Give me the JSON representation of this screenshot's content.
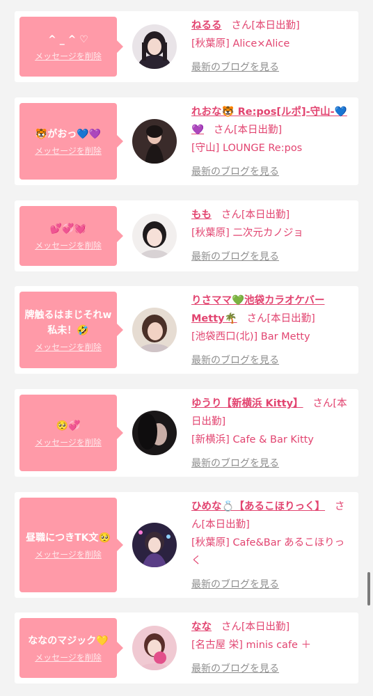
{
  "delete_label": "メッセージを削除",
  "blog_label": "最新のブログを見る",
  "san_label": "さん",
  "colors": {
    "accent": "#e24470",
    "bubble": "#ff9aa8",
    "background": "#f3f3f3"
  },
  "items": [
    {
      "message": "^ _ ^ ♡",
      "name": "ねるる",
      "status": "[本日出勤]",
      "area": "[秋葉原]",
      "shop": "Alice×Alice"
    },
    {
      "message": "🐯がおっ💙💜",
      "name": "れおな🐯 Re:pos[ルポ]-守山-💙💜",
      "status": "[本日出勤]",
      "area": "[守山]",
      "shop": "LOUNGE Re:pos"
    },
    {
      "message": "💕💞💓",
      "name": "もも",
      "status": "[本日出勤]",
      "area": "[秋葉原]",
      "shop": "二次元カノジョ"
    },
    {
      "message": "牌触るはまじそれw私未！🤣",
      "name": "りさママ💚池袋カラオケバーMetty🌴",
      "status": "[本日出勤]",
      "area": "[池袋西口(北)]",
      "shop": "Bar Metty"
    },
    {
      "message": "🥺💞",
      "name": "ゆうり【新横浜 Kitty】",
      "status": "[本日出勤]",
      "area": "[新横浜]",
      "shop": "Cafe & Bar Kitty"
    },
    {
      "message": "昼職につきTK文🥺",
      "name": "ひめな💍【あるこほりっく】",
      "status": "[本日出勤]",
      "area": "[秋葉原]",
      "shop": "Cafe&Bar あるこほりっく"
    },
    {
      "message": "ななのマジック💛",
      "name": "なな",
      "status": "[本日出勤]",
      "area": "[名古屋 栄]",
      "shop": "minis cafe ＋"
    }
  ]
}
